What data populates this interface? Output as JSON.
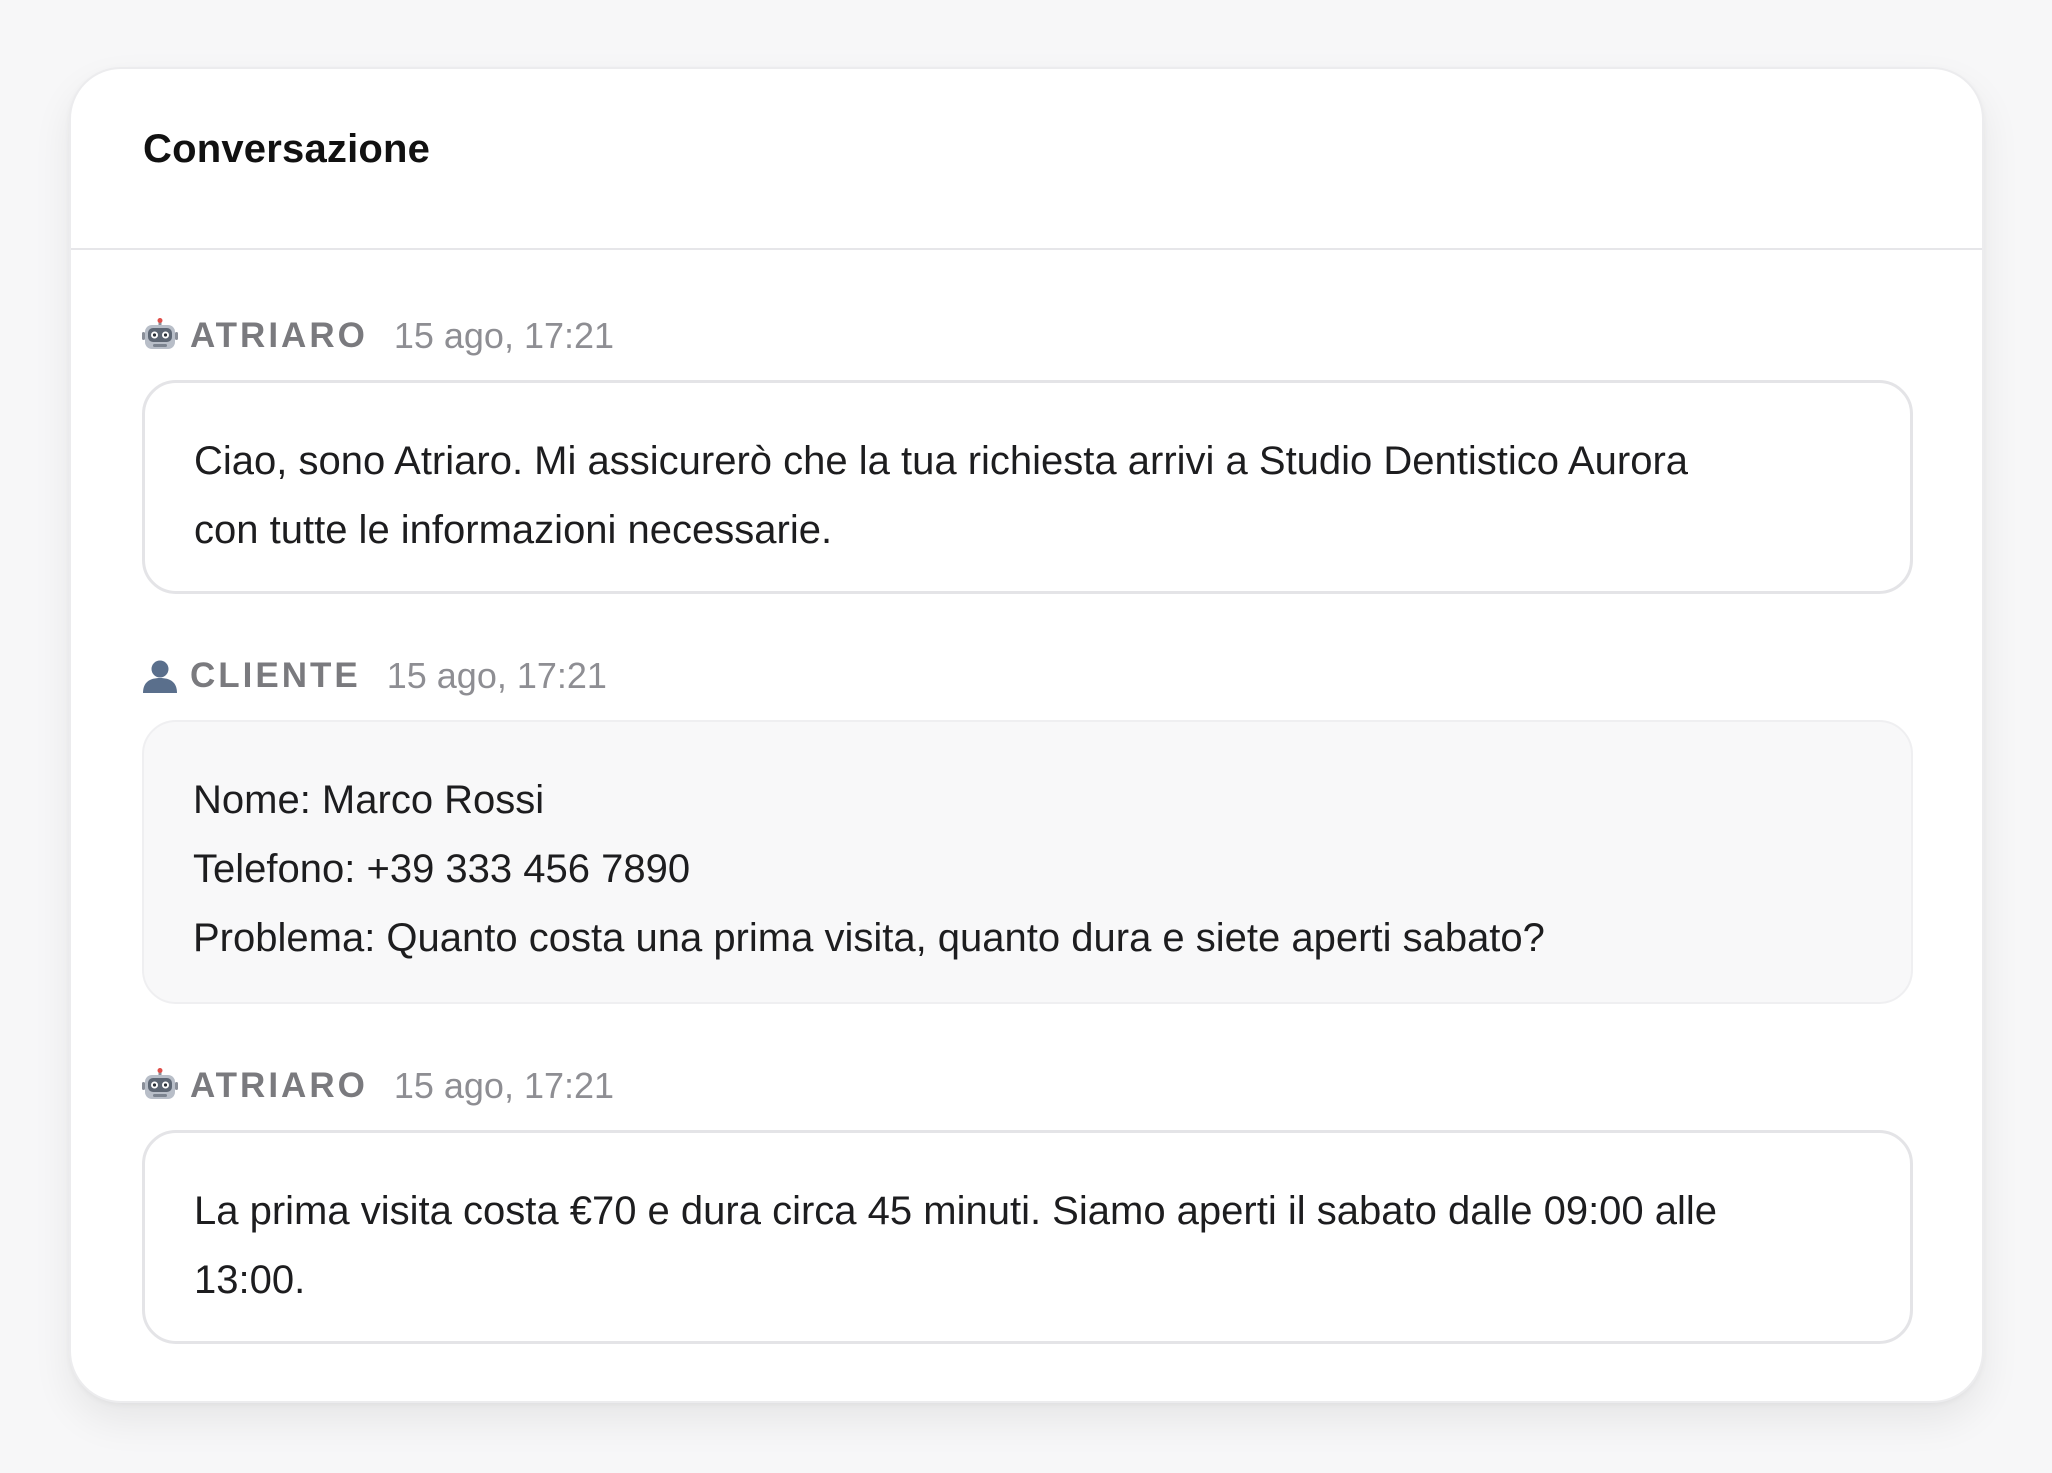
{
  "panel": {
    "title": "Conversazione"
  },
  "messages": [
    {
      "role": "bot",
      "icon": "robot-icon",
      "sender": "ATRIARO",
      "timestamp": "15 ago, 17:21",
      "text": "Ciao, sono Atriaro. Mi assicurerò che la tua richiesta arrivi a Studio Dentistico Aurora\ncon tutte le informazioni necessarie."
    },
    {
      "role": "user",
      "icon": "user-icon",
      "sender": "CLIENTE",
      "timestamp": "15 ago, 17:21",
      "text": "Nome: Marco Rossi\nTelefono: +39 333 456 7890\nProblema: Quanto costa una prima visita, quanto dura e siete aperti sabato?"
    },
    {
      "role": "bot",
      "icon": "robot-icon",
      "sender": "ATRIARO",
      "timestamp": "15 ago, 17:21",
      "text": "La prima visita costa €70 e dura circa 45 minuti. Siamo aperti il sabato dalle 09:00 alle\n13:00."
    }
  ],
  "colors": {
    "background": "#f7f7f8",
    "card": "#ffffff",
    "bot_bubble_border": "#e4e4e7",
    "user_bubble_bg": "#f8f8f9",
    "meta_label": "#7a7a7e",
    "timestamp": "#8e8e93",
    "user_icon": "#5a6f8c"
  }
}
